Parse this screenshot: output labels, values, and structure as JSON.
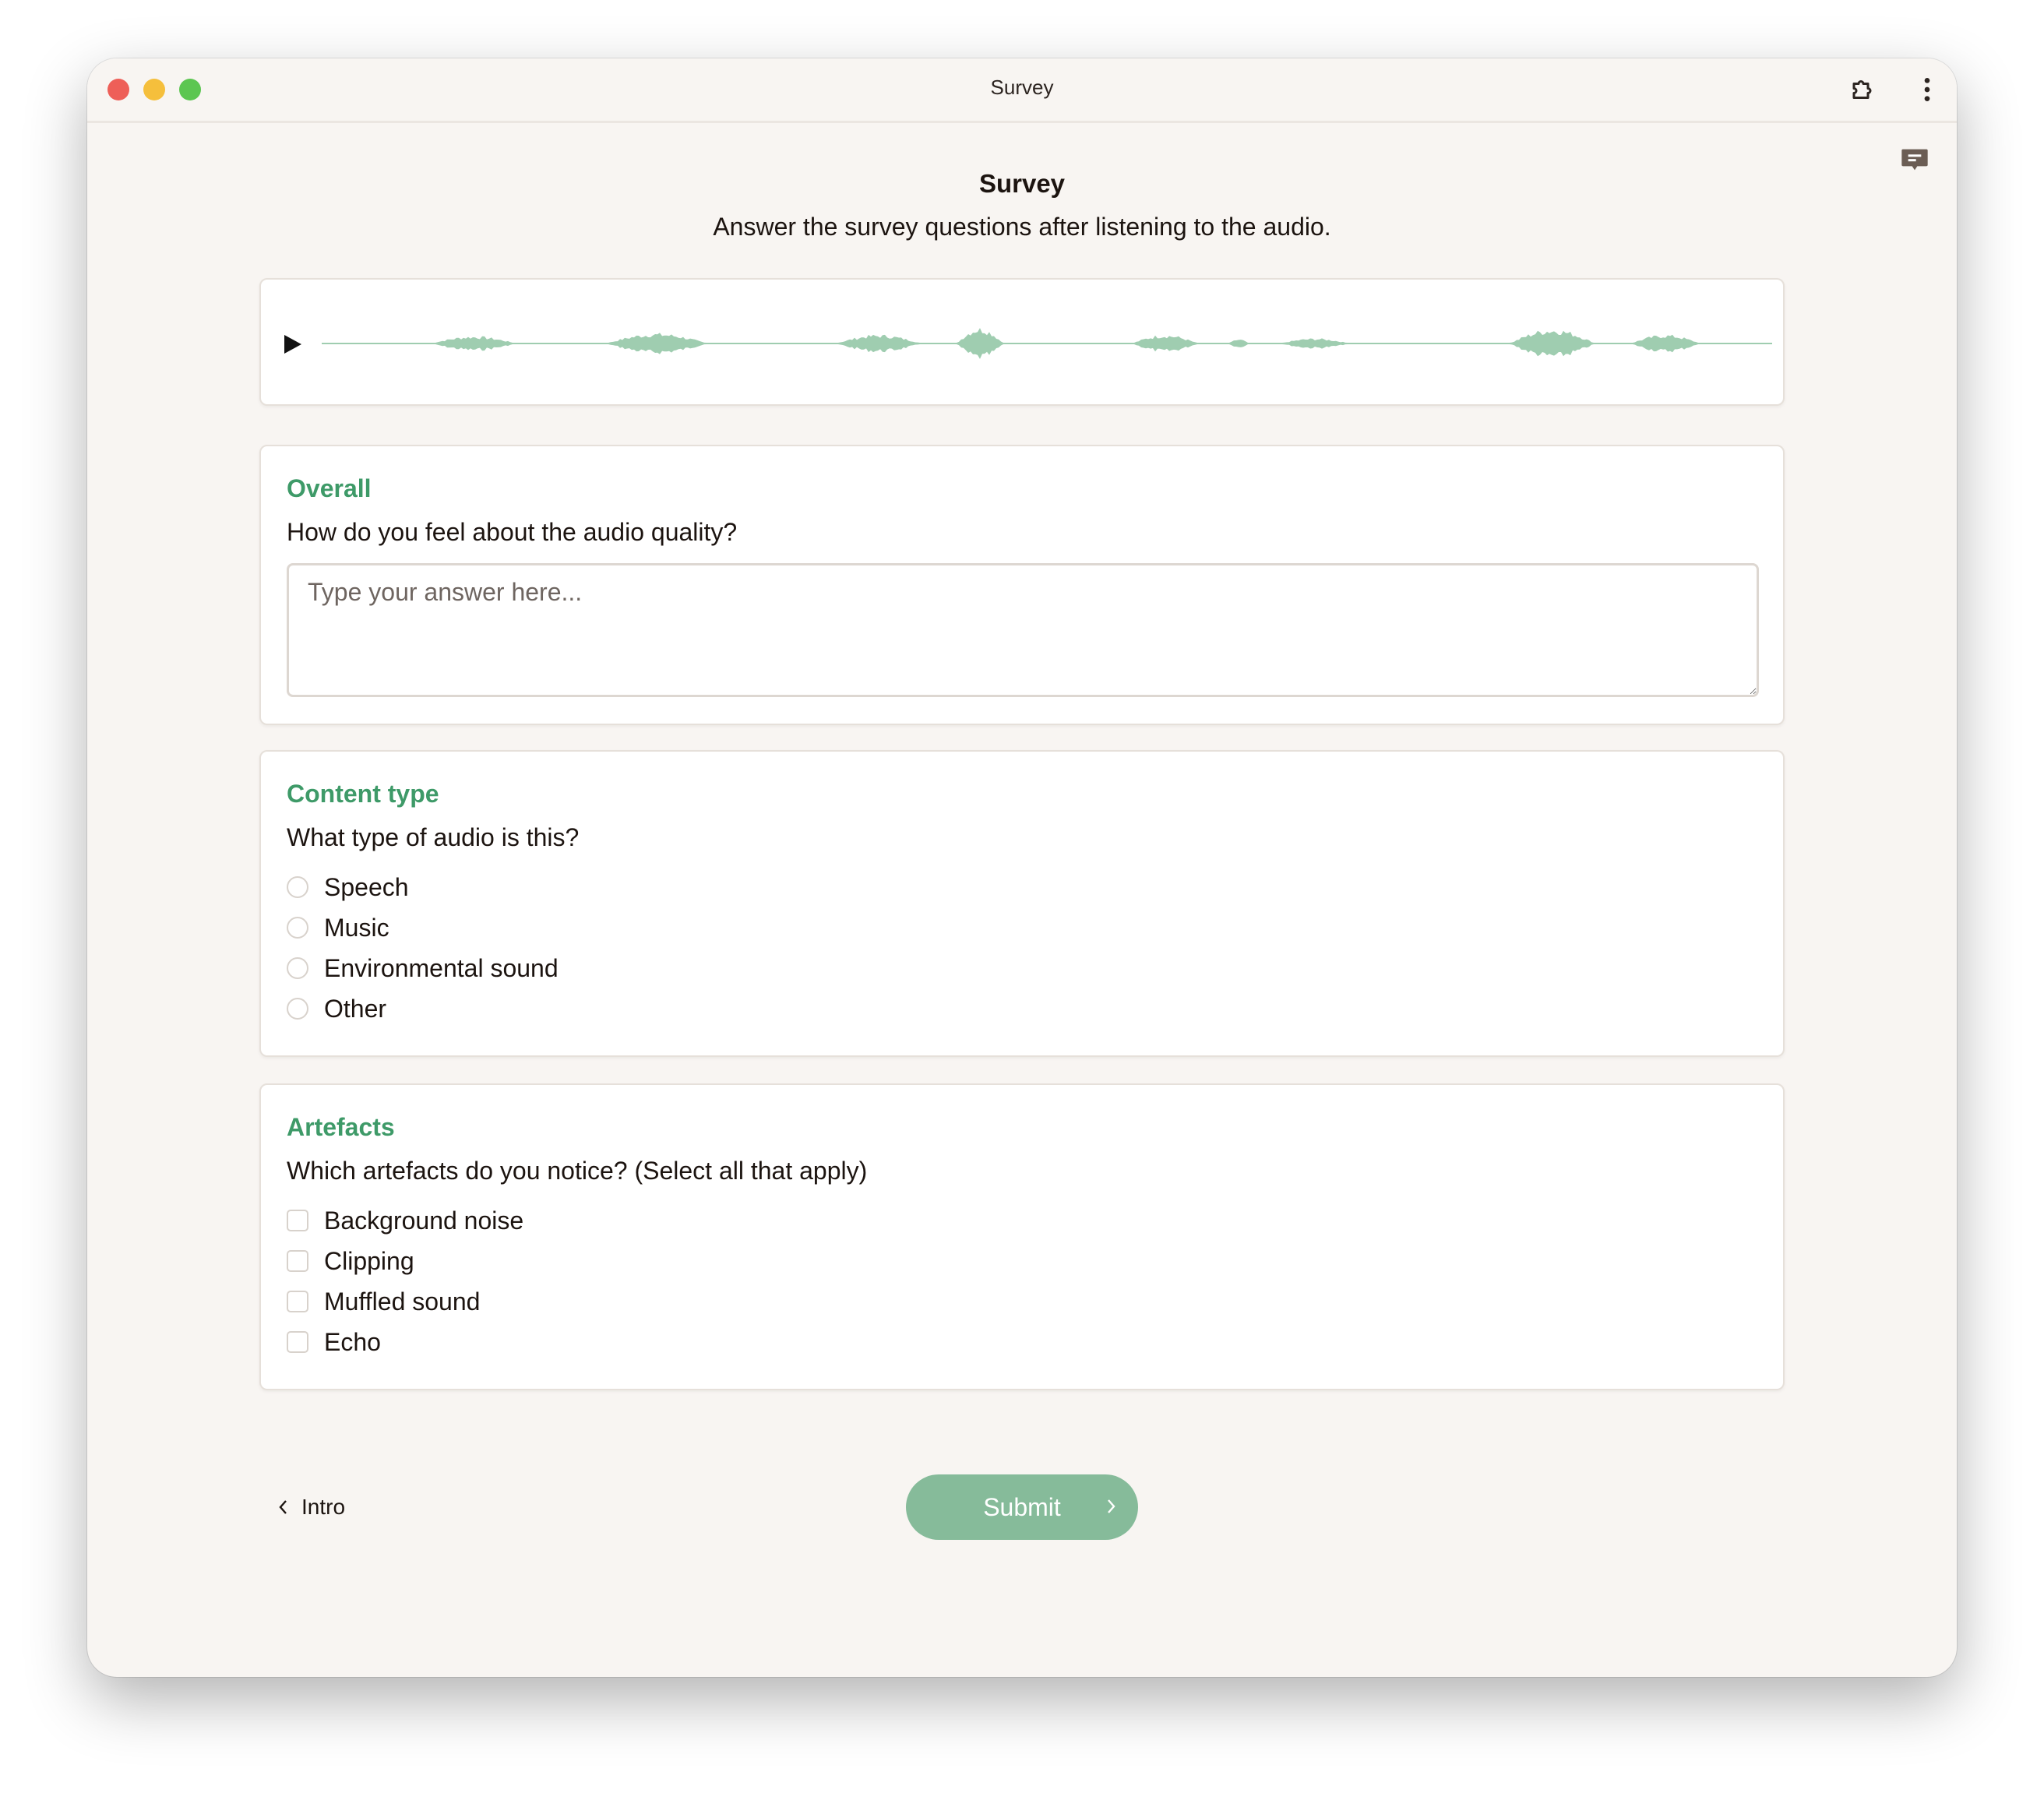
{
  "window": {
    "title": "Survey"
  },
  "header": {
    "title": "Survey",
    "subtitle": "Answer the survey questions after listening to the audio."
  },
  "player": {
    "play_icon": "play-icon",
    "waveform_color": "#9fcdb0"
  },
  "questions": [
    {
      "title": "Overall",
      "text": "How do you feel about the audio quality?",
      "type": "text",
      "placeholder": "Type your answer here...",
      "value": ""
    },
    {
      "title": "Content type",
      "text": "What type of audio is this?",
      "type": "radio",
      "options": [
        "Speech",
        "Music",
        "Environmental sound",
        "Other"
      ]
    },
    {
      "title": "Artefacts",
      "text": "Which artefacts do you notice? (Select all that apply)",
      "type": "checkbox",
      "options": [
        "Background noise",
        "Clipping",
        "Muffled sound",
        "Echo"
      ]
    }
  ],
  "nav": {
    "back_label": "Intro",
    "submit_label": "Submit"
  },
  "colors": {
    "accent": "#3e9a68",
    "submit_bg": "#86bb9a",
    "background": "#f8f5f2"
  }
}
